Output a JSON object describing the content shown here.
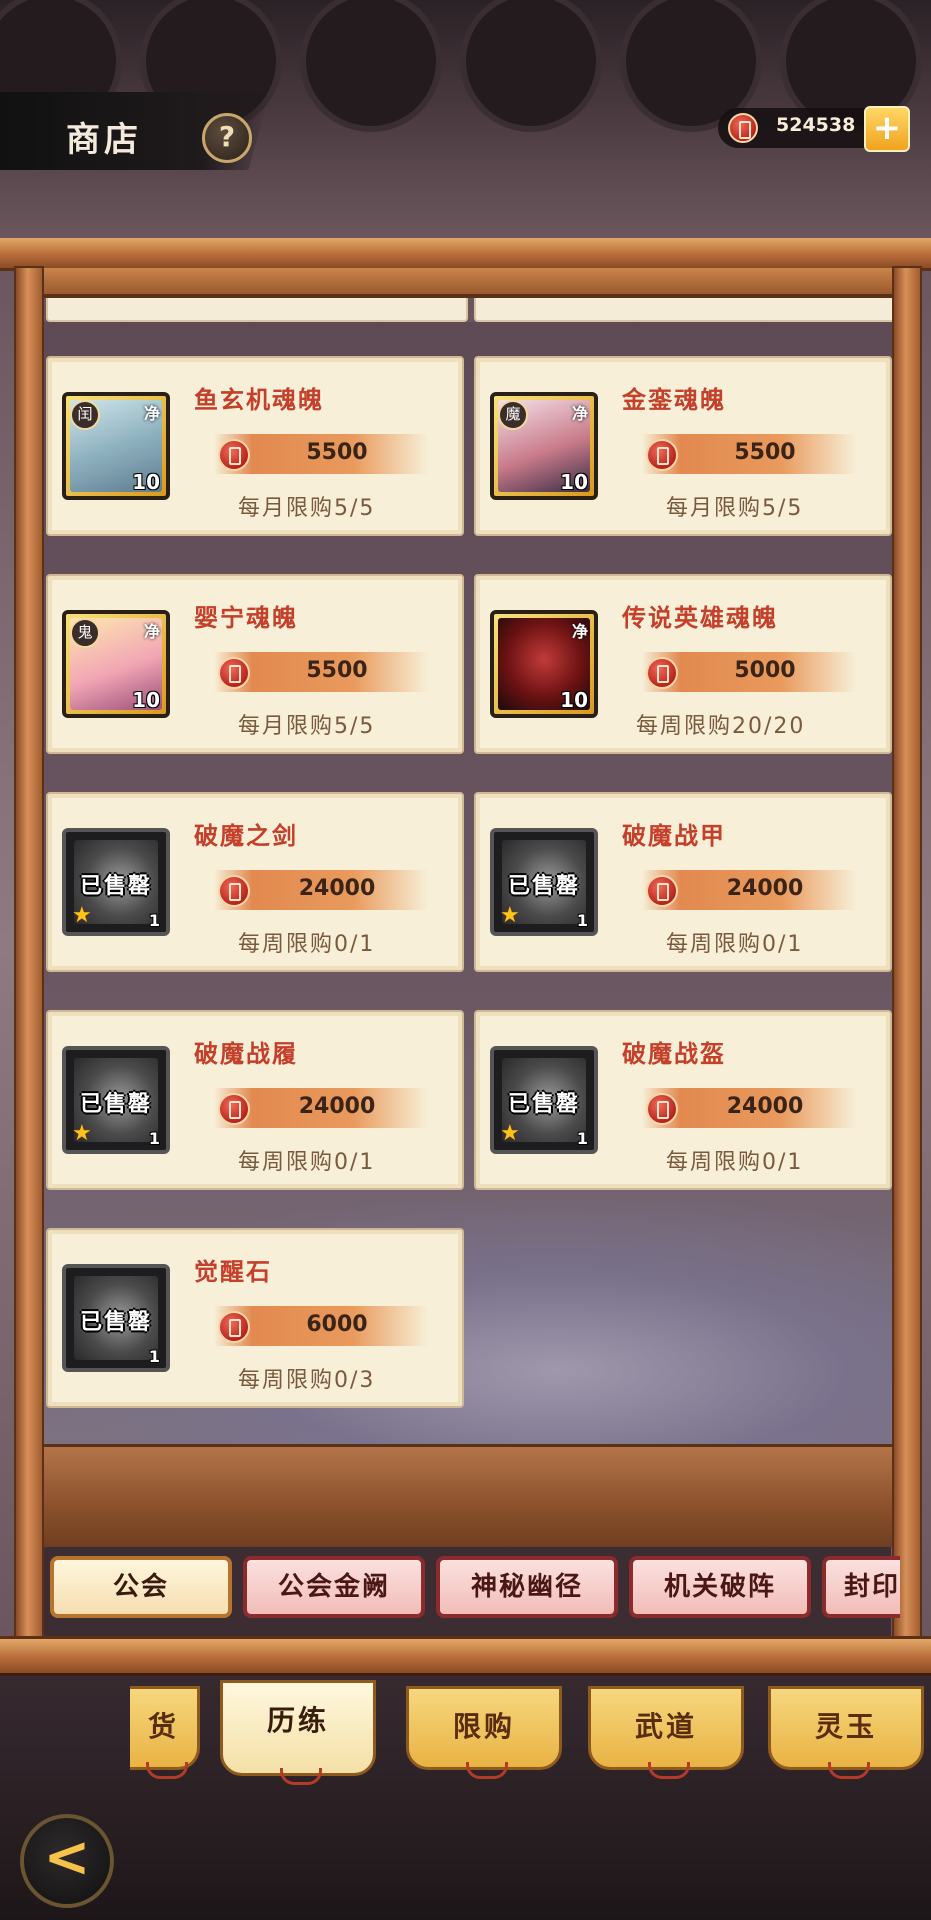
{
  "header": {
    "title": "商店",
    "help": "?",
    "currency_value": "524538",
    "add_button": "+"
  },
  "shop_items": [
    {
      "name": "鱼玄机魂魄",
      "price": "5500",
      "limit": "每月限购5/5",
      "qty": "10",
      "faction": "闰",
      "corner": "净",
      "sold": ""
    },
    {
      "name": "金銮魂魄",
      "price": "5500",
      "limit": "每月限购5/5",
      "qty": "10",
      "faction": "魔",
      "corner": "净",
      "sold": ""
    },
    {
      "name": "婴宁魂魄",
      "price": "5500",
      "limit": "每月限购5/5",
      "qty": "10",
      "faction": "鬼",
      "corner": "净",
      "sold": ""
    },
    {
      "name": "传说英雄魂魄",
      "price": "5000",
      "limit": "每周限购20/20",
      "qty": "10",
      "faction": "",
      "corner": "净",
      "sold": ""
    },
    {
      "name": "破魔之剑",
      "price": "24000",
      "limit": "每周限购0/1",
      "qty": "1",
      "faction": "",
      "corner": "",
      "sold": "已售罄"
    },
    {
      "name": "破魔战甲",
      "price": "24000",
      "limit": "每周限购0/1",
      "qty": "1",
      "faction": "",
      "corner": "",
      "sold": "已售罄"
    },
    {
      "name": "破魔战履",
      "price": "24000",
      "limit": "每周限购0/1",
      "qty": "1",
      "faction": "",
      "corner": "",
      "sold": "已售罄"
    },
    {
      "name": "破魔战盔",
      "price": "24000",
      "limit": "每周限购0/1",
      "qty": "1",
      "faction": "",
      "corner": "",
      "sold": "已售罄"
    },
    {
      "name": "觉醒石",
      "price": "6000",
      "limit": "每周限购0/3",
      "qty": "1",
      "faction": "",
      "corner": "",
      "sold": "已售罄"
    }
  ],
  "sub_tabs": [
    "公会",
    "公会金阙",
    "神秘幽径",
    "机关破阵",
    "封印"
  ],
  "main_tabs": [
    "货",
    "历练",
    "限购",
    "武道",
    "灵玉"
  ],
  "back_button": "<",
  "colors": {
    "accent_red": "#c4402a",
    "frame_wood": "#b86c3a",
    "card_bg": "#f7efd8",
    "tab_gold": "#e9b344"
  }
}
